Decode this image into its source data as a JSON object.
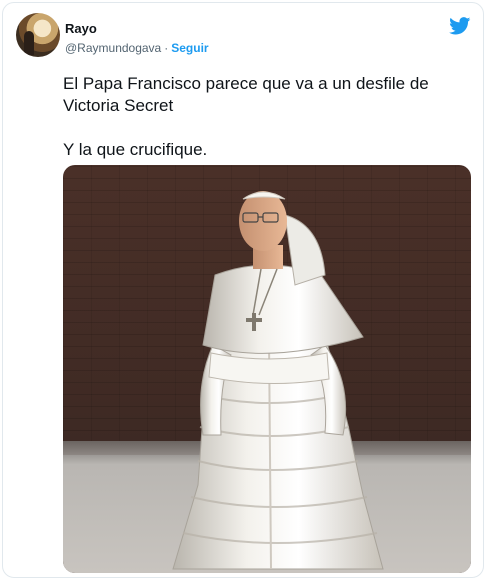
{
  "tweet": {
    "display_name": "Rayo",
    "handle": "@Raymundogava",
    "separator": "·",
    "follow_label": "Seguir",
    "text": "El Papa Francisco parece que va a un desfile de\nVictoria Secret\n\nY la que crucifique."
  },
  "colors": {
    "accent": "#1d9bf0",
    "text": "#0f1419",
    "secondary": "#536471"
  },
  "icons": {
    "platform": "twitter-bird-icon"
  }
}
